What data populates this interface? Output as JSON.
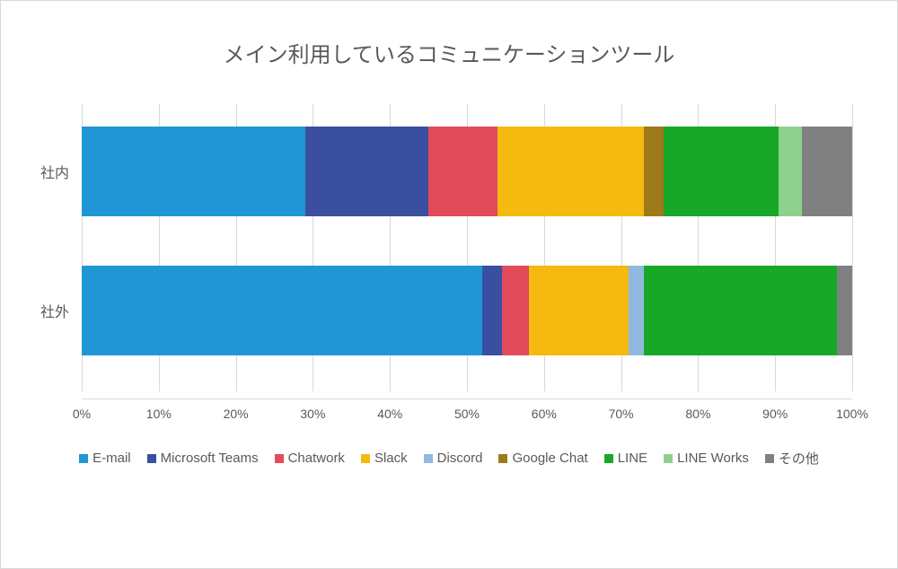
{
  "chart_data": {
    "type": "bar",
    "orientation": "horizontal-stacked-100",
    "title": "メイン利用しているコミュニケーションツール",
    "categories": [
      "社内",
      "社外"
    ],
    "series": [
      {
        "name": "E-mail",
        "color": "#2196d6",
        "values": [
          29.0,
          52.0
        ]
      },
      {
        "name": "Microsoft Teams",
        "color": "#3a4fa0",
        "values": [
          16.0,
          2.5
        ]
      },
      {
        "name": "Chatwork",
        "color": "#e14b5a",
        "values": [
          9.0,
          3.5
        ]
      },
      {
        "name": "Slack",
        "color": "#f6b90f",
        "values": [
          19.0,
          13.0
        ]
      },
      {
        "name": "Discord",
        "color": "#8fb9e0",
        "values": [
          0.0,
          2.0
        ]
      },
      {
        "name": "Google Chat",
        "color": "#9e7a1a",
        "values": [
          2.5,
          0.0
        ]
      },
      {
        "name": "LINE",
        "color": "#17a827",
        "values": [
          15.0,
          25.0
        ]
      },
      {
        "name": "LINE Works",
        "color": "#8fd08f",
        "values": [
          3.0,
          0.0
        ]
      },
      {
        "name": "その他",
        "color": "#808080",
        "values": [
          6.5,
          2.0
        ]
      }
    ],
    "x_ticks": [
      "0%",
      "10%",
      "20%",
      "30%",
      "40%",
      "50%",
      "60%",
      "70%",
      "80%",
      "90%",
      "100%"
    ],
    "xlabel": "",
    "ylabel": ""
  }
}
